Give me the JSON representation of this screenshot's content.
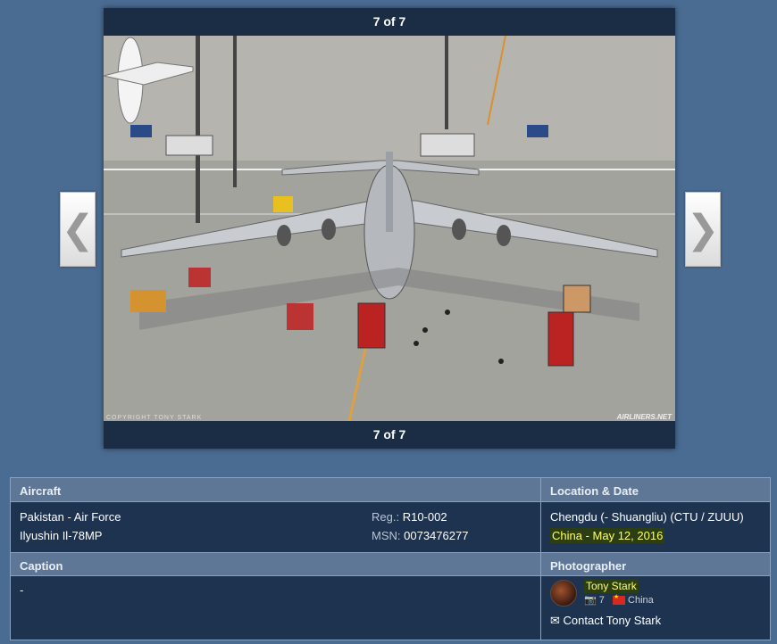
{
  "viewer": {
    "counter_top": "7 of 7",
    "counter_bottom": "7 of 7",
    "copyright": "COPYRIGHT TONY STARK",
    "watermark": "AIRLINERS.NET",
    "prev_icon": "chevron-left-icon",
    "next_icon": "chevron-right-icon"
  },
  "aircraft": {
    "header": "Aircraft",
    "operator": "Pakistan - Air Force",
    "type": "Ilyushin Il-78MP",
    "reg_label": "Reg.:",
    "reg_value": "R10-002",
    "msn_label": "MSN:",
    "msn_value": "0073476277"
  },
  "location": {
    "header": "Location & Date",
    "airport": "Chengdu (- Shuangliu) (CTU / ZUUU)",
    "country_date": "China - May 12, 2016"
  },
  "caption": {
    "header": "Caption",
    "text": "-"
  },
  "photographer": {
    "header": "Photographer",
    "name": "Tony Stark",
    "photo_count": "7",
    "country": "China",
    "contact": "Contact Tony Stark"
  },
  "colors": {
    "background": "#4a6c92",
    "header_bg": "#5f7796",
    "panel_bg": "#1d3350",
    "highlight": "#ffff66"
  }
}
